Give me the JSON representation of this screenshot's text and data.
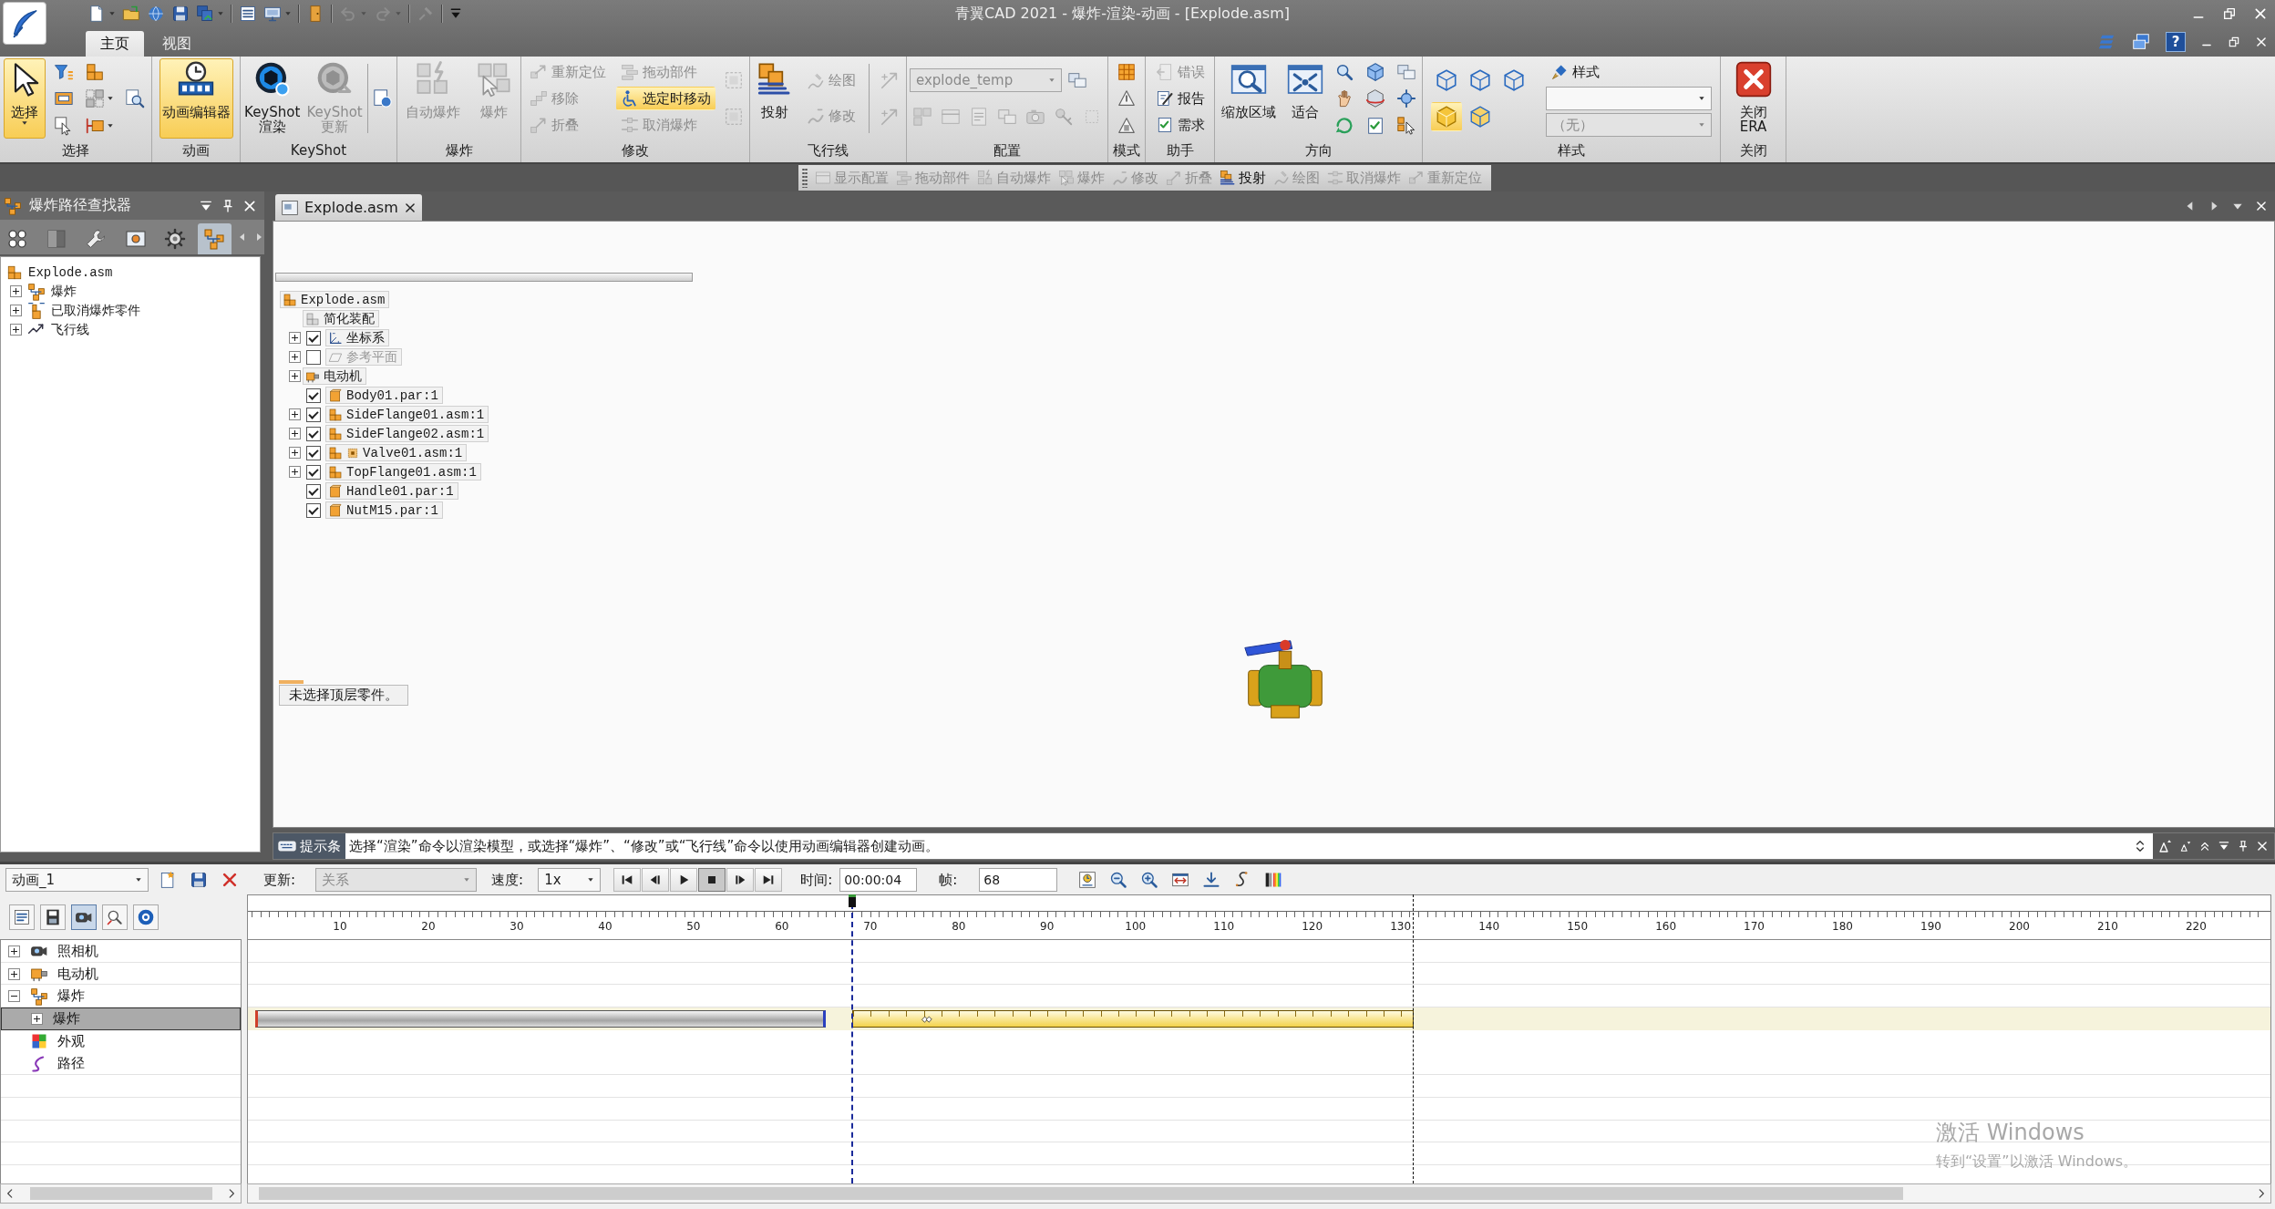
{
  "window": {
    "title": "青翼CAD 2021 - 爆炸-渲染-动画 - [Explode.asm]"
  },
  "quick_access": [
    {
      "disabled": false
    },
    {
      "disabled": false
    },
    {
      "disabled": false
    },
    {
      "disabled": false
    },
    {
      "disabled": false
    },
    {
      "disabled": false
    },
    {
      "disabled": false
    },
    {
      "disabled": false
    },
    {
      "disabled": true
    },
    {
      "disabled": true
    },
    {
      "disabled": true
    }
  ],
  "ribbon_tabs": [
    {
      "label": "主页",
      "selected": true
    },
    {
      "label": "视图",
      "selected": false
    }
  ],
  "help_button": "?",
  "ribbon_groups": [
    {
      "label": "选择",
      "items": [
        {
          "kind": "large",
          "label": "选择",
          "selected": true,
          "disabled": false
        },
        {
          "kind": "stack",
          "items": [
            {
              "kind": "icon",
              "selected": false,
              "disabled": false
            },
            {
              "kind": "icon",
              "selected": false,
              "disabled": false
            },
            {
              "kind": "icon",
              "selected": false,
              "disabled": false
            }
          ]
        },
        {
          "kind": "stack",
          "items": [
            {
              "kind": "icon",
              "selected": false,
              "disabled": false
            },
            {
              "kind": "icon",
              "selected": false,
              "disabled": false
            },
            {
              "kind": "icon",
              "selected": false,
              "disabled": false
            }
          ]
        },
        {
          "kind": "stack",
          "items": [
            {
              "kind": "icon",
              "selected": false,
              "disabled": false
            }
          ]
        }
      ]
    },
    {
      "label": "动画",
      "items": [
        {
          "kind": "large",
          "label": "动画编辑器",
          "selected": true,
          "disabled": false
        }
      ]
    },
    {
      "label": "KeyShot",
      "items": [
        {
          "kind": "large",
          "label": "KeyShot\n渲染",
          "selected": false,
          "disabled": false
        },
        {
          "kind": "large",
          "label": "KeyShot\n更新",
          "selected": false,
          "disabled": true
        },
        {
          "kind": "separator"
        },
        {
          "kind": "stack",
          "items": [
            {
              "kind": "icon",
              "selected": false,
              "disabled": false
            }
          ]
        }
      ]
    },
    {
      "label": "爆炸",
      "items": [
        {
          "kind": "large",
          "label": "自动爆炸",
          "selected": false,
          "disabled": true
        },
        {
          "kind": "large",
          "label": "爆炸",
          "selected": false,
          "disabled": true
        }
      ]
    },
    {
      "label": "修改",
      "items": [
        {
          "kind": "stack",
          "items": [
            {
              "kind": "small",
              "label": "重新定位",
              "selected": false,
              "disabled": true
            },
            {
              "kind": "small",
              "label": "移除",
              "selected": false,
              "disabled": true
            },
            {
              "kind": "small",
              "label": "折叠",
              "selected": false,
              "disabled": true
            }
          ]
        },
        {
          "kind": "stack",
          "items": [
            {
              "kind": "small",
              "label": "拖动部件",
              "selected": false,
              "disabled": true
            },
            {
              "kind": "small",
              "label": "选定时移动",
              "selected": true,
              "disabled": false
            },
            {
              "kind": "small",
              "label": "取消爆炸",
              "selected": false,
              "disabled": true
            }
          ]
        },
        {
          "kind": "stack",
          "items": [
            {
              "kind": "icon",
              "selected": false,
              "disabled": true
            },
            {
              "kind": "icon",
              "selected": false,
              "disabled": true
            }
          ]
        }
      ]
    },
    {
      "label": "飞行线",
      "items": [
        {
          "kind": "large",
          "label": "投射",
          "selected": false,
          "disabled": false
        },
        {
          "kind": "stack",
          "items": [
            {
              "kind": "small",
              "label": "绘图",
              "selected": false,
              "disabled": true
            },
            {
              "kind": "small",
              "label": "修改",
              "selected": false,
              "disabled": true
            }
          ]
        },
        {
          "kind": "separator"
        },
        {
          "kind": "stack",
          "items": [
            {
              "kind": "icon",
              "selected": false,
              "disabled": true
            },
            {
              "kind": "icon",
              "selected": false,
              "disabled": true
            }
          ]
        }
      ]
    },
    {
      "label": "配置",
      "items": [
        {
          "kind": "stack",
          "items": [
            {
              "kind": "row",
              "items": [
                {
                  "kind": "combo",
                  "value": "explode_temp",
                  "disabled": true
                },
                {
                  "kind": "icon",
                  "selected": false,
                  "disabled": false
                }
              ]
            },
            {
              "kind": "row",
              "items": [
                {
                  "kind": "icon",
                  "selected": false,
                  "disabled": true
                },
                {
                  "kind": "icon",
                  "selected": false,
                  "disabled": true
                },
                {
                  "kind": "icon",
                  "selected": false,
                  "disabled": true
                },
                {
                  "kind": "icon",
                  "selected": false,
                  "disabled": true
                },
                {
                  "kind": "icon",
                  "selected": false,
                  "disabled": true
                },
                {
                  "kind": "icon",
                  "selected": false,
                  "disabled": true
                },
                {
                  "kind": "icon",
                  "selected": false,
                  "disabled": true
                }
              ]
            }
          ]
        }
      ]
    },
    {
      "label": "模式",
      "items": [
        {
          "kind": "stack",
          "items": [
            {
              "kind": "icon",
              "selected": false,
              "disabled": false
            },
            {
              "kind": "icon",
              "selected": false,
              "disabled": false
            },
            {
              "kind": "icon",
              "selected": false,
              "disabled": false
            }
          ]
        }
      ]
    },
    {
      "label": "助手",
      "items": [
        {
          "kind": "stack",
          "items": [
            {
              "kind": "small",
              "label": "错误",
              "selected": false,
              "disabled": true
            },
            {
              "kind": "small",
              "label": "报告",
              "selected": false,
              "disabled": false
            },
            {
              "kind": "small",
              "label": "需求",
              "selected": false,
              "disabled": false
            }
          ]
        }
      ]
    },
    {
      "label": "方向",
      "items": [
        {
          "kind": "large",
          "label": "缩放区域",
          "selected": false,
          "disabled": false
        },
        {
          "kind": "large",
          "label": "适合",
          "selected": false,
          "disabled": false
        },
        {
          "kind": "stack",
          "items": [
            {
              "kind": "icon",
              "selected": false,
              "disabled": false
            },
            {
              "kind": "icon",
              "selected": false,
              "disabled": false
            },
            {
              "kind": "icon",
              "selected": false,
              "disabled": false
            }
          ]
        },
        {
          "kind": "stack",
          "items": [
            {
              "kind": "icon",
              "selected": false,
              "disabled": false
            },
            {
              "kind": "icon",
              "selected": false,
              "disabled": false
            },
            {
              "kind": "icon",
              "selected": false,
              "disabled": false
            }
          ]
        },
        {
          "kind": "stack",
          "items": [
            {
              "kind": "icon",
              "selected": false,
              "disabled": false
            },
            {
              "kind": "icon",
              "selected": false,
              "disabled": false
            },
            {
              "kind": "icon",
              "selected": false,
              "disabled": false
            }
          ]
        }
      ]
    },
    {
      "label": "样式",
      "items": [
        {
          "kind": "stack",
          "items": [
            {
              "kind": "row",
              "items": [
                {
                  "kind": "icon",
                  "selected": false,
                  "disabled": false
                },
                {
                  "kind": "icon",
                  "selected": false,
                  "disabled": false
                },
                {
                  "kind": "icon",
                  "selected": false,
                  "disabled": false
                }
              ]
            },
            {
              "kind": "row",
              "items": [
                {
                  "kind": "icon",
                  "selected": true,
                  "disabled": false
                },
                {
                  "kind": "icon",
                  "selected": false,
                  "disabled": false
                }
              ]
            }
          ]
        },
        {
          "kind": "stack",
          "items": [
            {
              "kind": "small",
              "label": "样式",
              "selected": false,
              "disabled": false
            },
            {
              "kind": "combo",
              "disabled": false
            },
            {
              "kind": "combo",
              "value": "（无）",
              "disabled": true
            }
          ]
        }
      ]
    },
    {
      "label": "关闭",
      "items": [
        {
          "kind": "large",
          "label": "关闭\nERA",
          "selected": false,
          "disabled": false
        }
      ]
    }
  ],
  "floating_toolbar": [
    {
      "label": "显示配置",
      "disabled": true
    },
    {
      "label": "拖动部件",
      "disabled": true
    },
    {
      "label": "自动爆炸",
      "disabled": true
    },
    {
      "label": "爆炸",
      "disabled": true
    },
    {
      "label": "修改",
      "disabled": true
    },
    {
      "label": "折叠",
      "disabled": true
    },
    {
      "label": "投射",
      "disabled": false
    },
    {
      "label": "绘图",
      "disabled": true
    },
    {
      "label": "取消爆炸",
      "disabled": true
    },
    {
      "label": "重新定位",
      "disabled": true
    }
  ],
  "left_panel": {
    "title": "爆炸路径查找器",
    "tabs": [
      {
        "selected": false
      },
      {
        "selected": false
      },
      {
        "selected": false
      },
      {
        "selected": false
      },
      {
        "selected": false
      },
      {
        "selected": true
      }
    ],
    "tree": {
      "label": "Explode.asm",
      "kind": "assembly",
      "children": [
        {
          "label": "爆炸",
          "kind": "explode",
          "expanded": false
        },
        {
          "label": "已取消爆炸零件",
          "kind": "unexploded",
          "expanded": false
        },
        {
          "label": "飞行线",
          "kind": "flyline",
          "expanded": false
        }
      ]
    }
  },
  "document": {
    "tab": "Explode.asm",
    "tree": {
      "label": "Explode.asm",
      "kind": "assembly",
      "children": [
        {
          "label": "简化装配",
          "kind": "simplified"
        },
        {
          "label": "坐标系",
          "kind": "coordinates",
          "expanded": false,
          "checked": true
        },
        {
          "label": "参考平面",
          "kind": "planes",
          "expanded": false,
          "checked": false
        },
        {
          "label": "电动机",
          "kind": "motor",
          "expanded": false
        },
        {
          "label": "Body01.par:1",
          "kind": "part",
          "checked": true
        },
        {
          "label": "SideFlange01.asm:1",
          "kind": "assembly",
          "expanded": false,
          "checked": true
        },
        {
          "label": "SideFlange02.asm:1",
          "kind": "assembly",
          "expanded": false,
          "checked": true
        },
        {
          "label": "Valve01.asm:1",
          "kind": "pattern_assembly",
          "expanded": false,
          "checked": true
        },
        {
          "label": "TopFlange01.asm:1",
          "kind": "assembly",
          "expanded": false,
          "checked": true
        },
        {
          "label": "Handle01.par:1",
          "kind": "part",
          "checked": true
        },
        {
          "label": "NutM15.par:1",
          "kind": "part",
          "checked": true
        }
      ]
    },
    "status": "未选择顶层零件。"
  },
  "hint_bar": {
    "label": "提示条",
    "text": "选择“渲染”命令以渲染模型，或选择“爆炸”、“修改”或“飞行线”命令以使用动画编辑器创建动画。"
  },
  "animation_editor": {
    "animation": "动画_1",
    "update": {
      "label": "更新:",
      "value": "关系",
      "disabled": true
    },
    "speed": {
      "label": "速度:",
      "value": "1x"
    },
    "playback": [
      {
        "selected": false
      },
      {
        "selected": false
      },
      {
        "selected": false
      },
      {
        "selected": true
      },
      {
        "selected": false
      },
      {
        "selected": false
      }
    ],
    "time": {
      "label": "时间:",
      "value": "00:00:04"
    },
    "frame": {
      "label": "帧:",
      "value": "68"
    },
    "view_buttons": [
      {
        "selected": false
      },
      {
        "selected": false
      },
      {
        "selected": true
      },
      {
        "selected": false
      },
      {
        "selected": false
      }
    ],
    "tracks": [
      {
        "label": "照相机",
        "kind": "camera",
        "expanded": false,
        "selected": false
      },
      {
        "label": "电动机",
        "kind": "motor",
        "expanded": false,
        "selected": false
      },
      {
        "label": "爆炸",
        "kind": "explode",
        "expanded": true,
        "selected": false,
        "children": [
          {
            "label": "爆炸",
            "kind": "event",
            "expanded": false,
            "selected": true
          }
        ]
      },
      {
        "label": "外观",
        "kind": "appearance",
        "selected": false
      },
      {
        "label": "路径",
        "kind": "path",
        "selected": false
      }
    ],
    "ruler": [
      "10",
      "20",
      "30",
      "40",
      "50",
      "60",
      "70",
      "80",
      "90",
      "100",
      "110",
      "120",
      "130",
      "140",
      "150",
      "160",
      "170",
      "180",
      "190",
      "200",
      "210",
      "220"
    ],
    "playhead": {
      "level": 0.298
    }
  },
  "activation_notice": {
    "title": "激活 Windows",
    "text": "转到“设置”以激活 Windows。"
  }
}
